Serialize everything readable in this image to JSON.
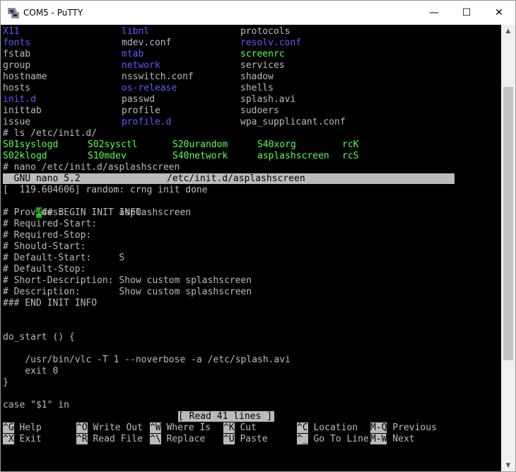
{
  "window": {
    "title": "COM5 - PuTTY",
    "min_glyph": "—",
    "max_glyph": "☐",
    "close_glyph": "✕",
    "icon": "putty-icon"
  },
  "terminal": {
    "ls_etc": [
      [
        "X11",
        "libnl",
        "protocols"
      ],
      [
        "fonts",
        "mdev.conf",
        "resolv.conf"
      ],
      [
        "fstab",
        "mtab",
        "screenrc"
      ],
      [
        "group",
        "network",
        "services"
      ],
      [
        "hostname",
        "nsswitch.conf",
        "shadow"
      ],
      [
        "hosts",
        "os-release",
        "shells"
      ],
      [
        "init.d",
        "passwd",
        "splash.avi"
      ],
      [
        "inittab",
        "profile",
        "sudoers"
      ],
      [
        "issue",
        "profile.d",
        "wpa_supplicant.conf"
      ]
    ],
    "cmd_ls": "# ls /etc/init.d/",
    "ls_initd": [
      [
        "S01syslogd",
        "S02sysctl",
        "S20urandom",
        "S40xorg",
        "rcK"
      ],
      [
        "S02klogd",
        "S10mdev",
        "S40network",
        "asplashscreen",
        "rcS"
      ]
    ],
    "cmd_nano": "# nano /etc/init.d/asplashscreen",
    "nano_version": "  GNU nano 5.2",
    "nano_file": "/etc/init.d/asplashscreen",
    "kernel_msg": "[  119.604606] random: crng init done",
    "cursor_char": "#",
    "file_lines": [
      "## BEGIN INIT INFO",
      "# Provides:          asplashscreen",
      "# Required-Start:",
      "# Required-Stop:",
      "# Should-Start:",
      "# Default-Start:     S",
      "# Default-Stop:",
      "# Short-Description: Show custom splashscreen",
      "# Description:       Show custom splashscreen",
      "### END INIT INFO",
      "",
      "",
      "do_start () {",
      "",
      "    /usr/bin/vlc -T 1 --noverbose -a /etc/splash.avi",
      "    exit 0",
      "}",
      "",
      "case \"$1\" in"
    ],
    "status": "[ Read 41 lines ]",
    "shortcuts": [
      [
        {
          "key": "^G",
          "label": " Help"
        },
        {
          "key": "^O",
          "label": " Write Out"
        },
        {
          "key": "^W",
          "label": " Where Is"
        },
        {
          "key": "^K",
          "label": " Cut"
        },
        {
          "key": "^C",
          "label": " Location"
        },
        {
          "key": "M-Q",
          "label": " Previous"
        }
      ],
      [
        {
          "key": "^X",
          "label": " Exit"
        },
        {
          "key": "^R",
          "label": " Read File"
        },
        {
          "key": "^\\",
          "label": " Replace"
        },
        {
          "key": "^U",
          "label": " Paste"
        },
        {
          "key": "^_",
          "label": " Go To Line"
        },
        {
          "key": "M-W",
          "label": " Next"
        }
      ]
    ]
  },
  "scrollbar": {
    "up_glyph": "▲",
    "down_glyph": "▼"
  }
}
